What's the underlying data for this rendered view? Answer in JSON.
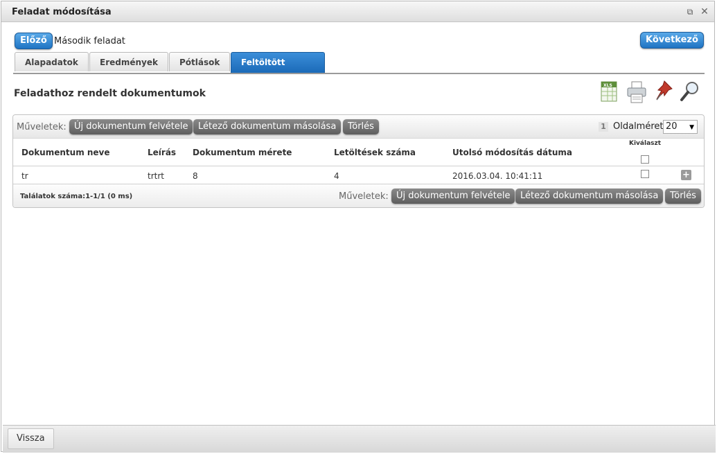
{
  "window": {
    "title": "Feladat módosítása"
  },
  "nav": {
    "prev_label": "Előző",
    "task_name": "Második feladat",
    "next_label": "Következő"
  },
  "tabs": [
    {
      "label": "Alapadatok",
      "active": false
    },
    {
      "label": "Eredmények",
      "active": false
    },
    {
      "label": "Pótlások",
      "active": false
    },
    {
      "label": "Feltöltött dokumentumok",
      "active": true
    }
  ],
  "section": {
    "title": "Feladathoz rendelt dokumentumok"
  },
  "toolbar_icons": [
    "xls-export-icon",
    "print-icon",
    "pin-icon",
    "search-icon"
  ],
  "grid": {
    "ops_label": "Műveletek:",
    "ops_buttons": [
      "Új dokumentum felvétele",
      "Létező dokumentum másolása",
      "Törlés"
    ],
    "page_number": "1",
    "page_size_label": "Oldalméret",
    "page_size_value": "20",
    "columns": [
      "Dokumentum neve",
      "Leírás",
      "Dokumentum mérete",
      "Letöltések száma",
      "Utolsó módosítás dátuma",
      "Kiválaszt"
    ],
    "rows": [
      {
        "name": "tr",
        "description": "trtrt",
        "size": "8",
        "downloads": "4",
        "modified": "2016.03.04. 10:41:11"
      }
    ],
    "results_text": "Találatok száma:1-1/1 (0 ms)"
  },
  "footer": {
    "back_label": "Vissza"
  },
  "colors": {
    "accent": "#1f74c3",
    "tab_active": "#1b6ab8",
    "button_gray": "#6e6e6e"
  }
}
